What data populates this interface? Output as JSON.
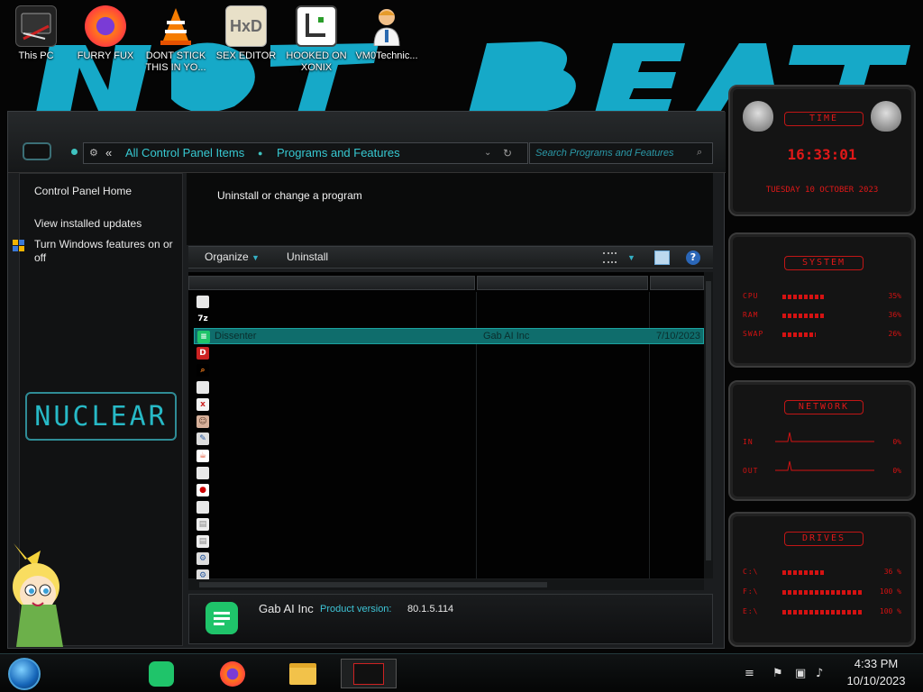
{
  "desktop": {
    "wallpaper_text": "NOT BEAST",
    "icons": [
      {
        "label": "This PC"
      },
      {
        "label": "FURRY FUX"
      },
      {
        "label": "DONT STICK THIS IN YO..."
      },
      {
        "label": "SEX EDITOR"
      },
      {
        "label": "HOOKED ON XONIX"
      },
      {
        "label": "VM0Technic..."
      }
    ]
  },
  "window": {
    "address": {
      "back_glyph": "«",
      "crumb1": "All Control Panel Items",
      "crumb2": "Programs and Features"
    },
    "search": {
      "placeholder": "Search Programs and Features"
    },
    "sidebar": {
      "home": "Control Panel Home",
      "updates": "View installed updates",
      "features": "Turn Windows features on or off",
      "logo": "NUCLEAR"
    },
    "content": {
      "title": "Uninstall or change a program"
    },
    "toolbar": {
      "organize": "Organize",
      "uninstall": "Uninstall",
      "help": "?"
    },
    "list": {
      "selected_row": {
        "name": "Dissenter",
        "publisher": "Gab AI Inc",
        "date": "7/10/2023"
      },
      "row_icons": [
        "window",
        "7z",
        "dissenter",
        "devcpp",
        "search",
        "window",
        "xpad",
        "portrait",
        "pen",
        "java",
        "window",
        "redhat",
        "window",
        "doc",
        "doc",
        "setup",
        "setup"
      ]
    },
    "details": {
      "publisher": "Gab AI Inc",
      "version_label": "Product version:",
      "version_value": "80.1.5.114"
    }
  },
  "gadgets": {
    "time": {
      "title": "TIME",
      "clock": "16:33:01",
      "date": "TUESDAY 10 OCTOBER 2023"
    },
    "system": {
      "title": "SYSTEM",
      "rows": [
        {
          "label": "CPU",
          "value": "35%",
          "level": 0.35
        },
        {
          "label": "RAM",
          "value": "36%",
          "level": 0.36
        },
        {
          "label": "SWAP",
          "value": "26%",
          "level": 0.26
        }
      ]
    },
    "network": {
      "title": "NETWORK",
      "rows": [
        {
          "label": "IN",
          "value": "0%"
        },
        {
          "label": "OUT",
          "value": "0%"
        }
      ]
    },
    "drives": {
      "title": "DRIVES",
      "rows": [
        {
          "label": "C:\\",
          "value": "36 %",
          "level": 0.36
        },
        {
          "label": "F:\\",
          "value": "100 %",
          "level": 1.0
        },
        {
          "label": "E:\\",
          "value": "100 %",
          "level": 1.0
        }
      ]
    }
  },
  "taskbar": {
    "apps": [
      "dissenter-app",
      "firefox-app",
      "file-explorer-app",
      "media-app"
    ],
    "time": "4:33 PM",
    "date": "10/10/2023"
  },
  "colors": {
    "accent": "#37c9d2",
    "gadget_red": "#d51212",
    "selection": "#0f6d6c"
  }
}
